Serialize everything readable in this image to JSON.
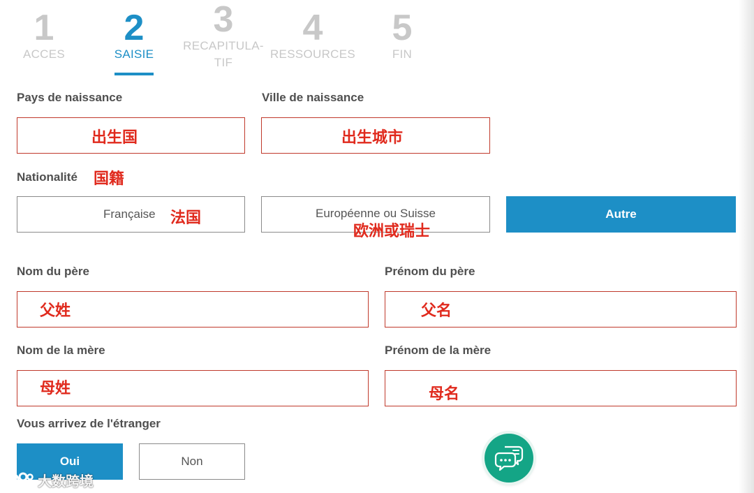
{
  "stepper": {
    "steps": [
      {
        "number": "1",
        "label": "ACCES"
      },
      {
        "number": "2",
        "label": "SAISIE"
      },
      {
        "number": "3",
        "label_line1": "RECAPITULA-",
        "label_line2": "TIF"
      },
      {
        "number": "4",
        "label": "RESSOURCES"
      },
      {
        "number": "5",
        "label": "FIN"
      }
    ],
    "active_step": "2"
  },
  "birth": {
    "country_label": "Pays de naissance",
    "country_annotation": "出生国",
    "city_label": "Ville de naissance",
    "city_annotation": "出生城市"
  },
  "nationality": {
    "label": "Nationalité",
    "annotation": "国籍",
    "options": [
      {
        "label": "Française",
        "annotation": "法国"
      },
      {
        "label": "Européenne ou Suisse",
        "annotation": "欧洲或瑞士"
      },
      {
        "label": "Autre"
      }
    ],
    "selected": "Autre"
  },
  "father": {
    "last_name_label": "Nom du père",
    "last_name_annotation": "父姓",
    "first_name_label": "Prénom du père",
    "first_name_annotation": "父名"
  },
  "mother": {
    "last_name_label": "Nom de la mère",
    "last_name_annotation": "母姓",
    "first_name_label": "Prénom de la mère",
    "first_name_annotation": "母名"
  },
  "abroad": {
    "label": "Vous arrivez de l'étranger",
    "options": [
      "Oui",
      "Non"
    ],
    "selected": "Oui"
  },
  "chat": {
    "icon": "chat-bubbles-icon"
  },
  "watermark": {
    "text": "大数跨境"
  },
  "colors": {
    "accent": "#1d8fc6",
    "annotation_red": "#e02a1d",
    "chat_green": "#14a586",
    "inactive_step": "#c8c8c8"
  }
}
